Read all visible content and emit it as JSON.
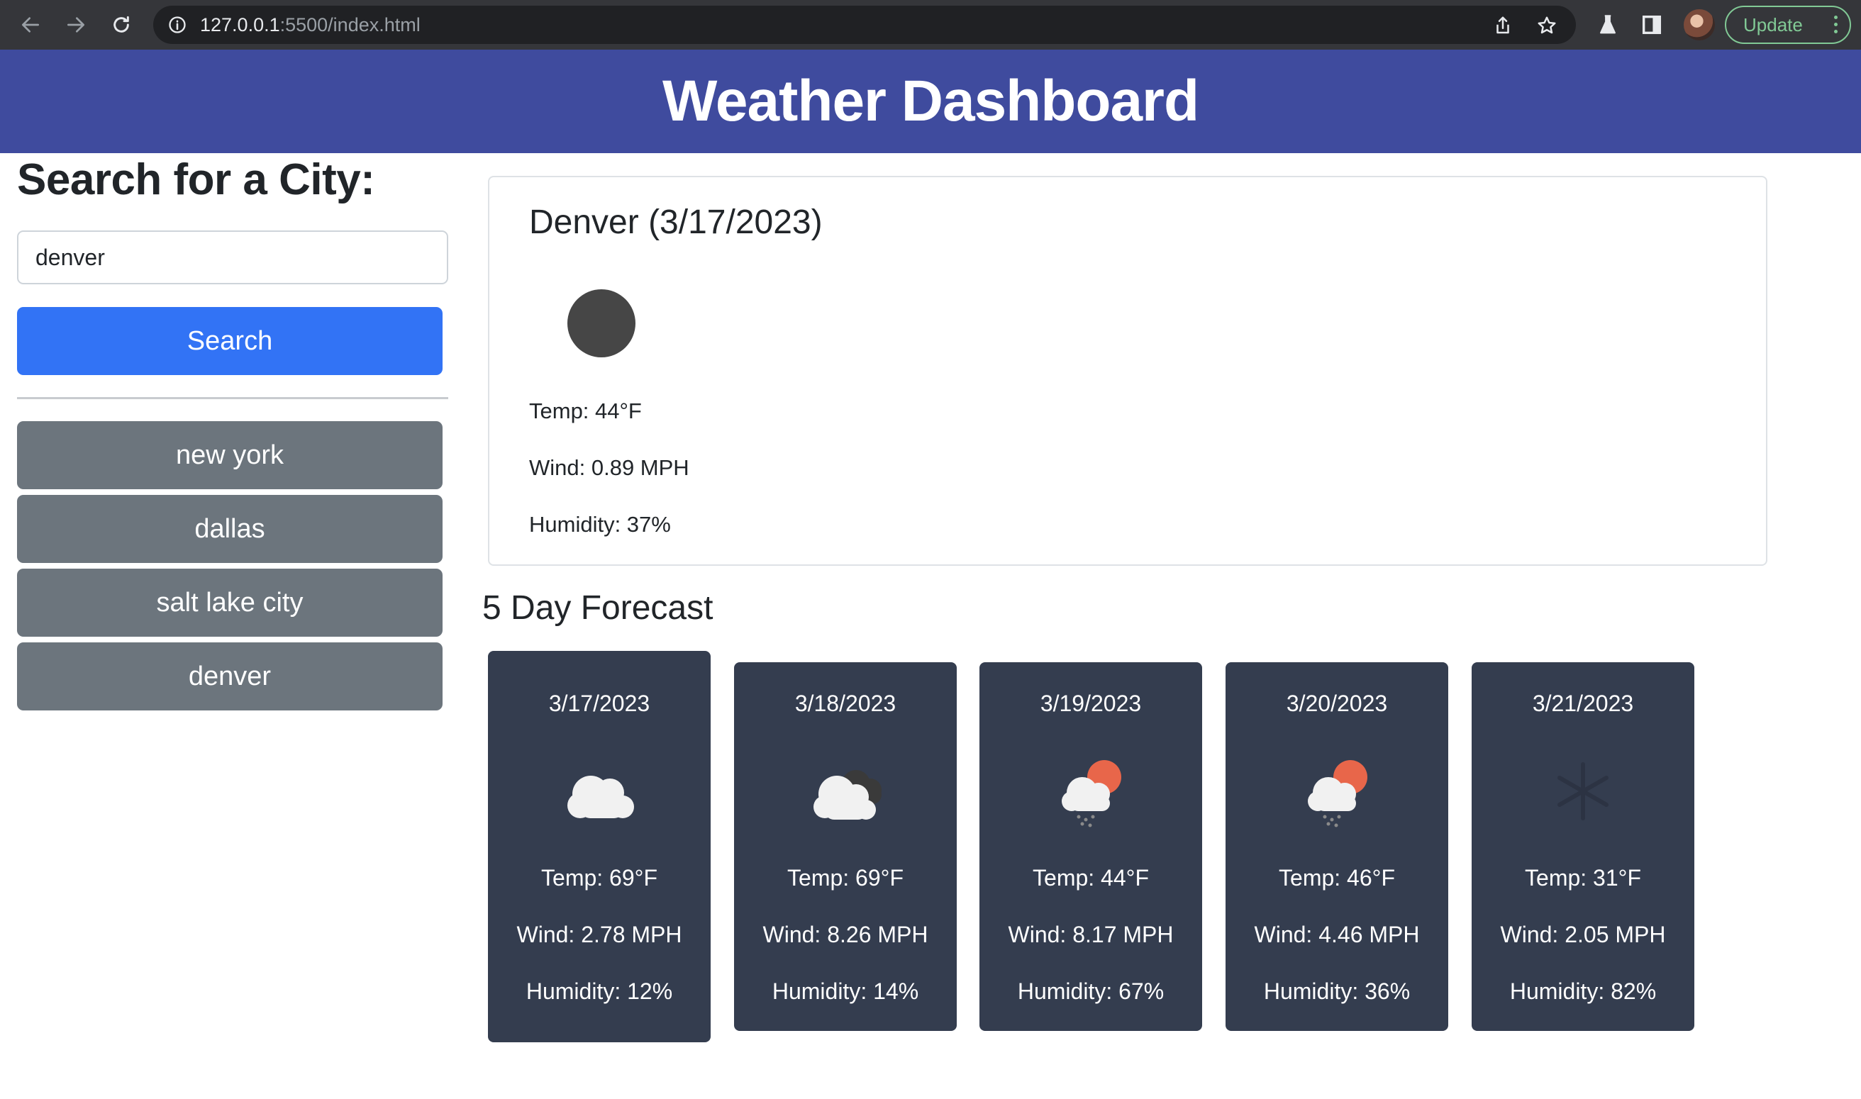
{
  "browser": {
    "url_host": "127.0.0.1",
    "url_path": ":5500/index.html",
    "update_label": "Update"
  },
  "header": {
    "title": "Weather Dashboard"
  },
  "search": {
    "heading": "Search for a City:",
    "input_value": "denver",
    "button_label": "Search"
  },
  "history": [
    "new york",
    "dallas",
    "salt lake city",
    "denver"
  ],
  "current": {
    "title": "Denver (3/17/2023)",
    "icon": "dark-circle-icon",
    "temp": "Temp: 44°F",
    "wind": "Wind: 0.89 MPH",
    "humidity": "Humidity: 37%"
  },
  "forecast": {
    "heading": "5 Day Forecast",
    "days": [
      {
        "date": "3/17/2023",
        "icon": "cloud-icon",
        "temp": "Temp: 69°F",
        "wind": "Wind: 2.78 MPH",
        "humidity": "Humidity: 12%"
      },
      {
        "date": "3/18/2023",
        "icon": "broken-clouds-icon",
        "temp": "Temp: 69°F",
        "wind": "Wind: 8.26 MPH",
        "humidity": "Humidity: 14%"
      },
      {
        "date": "3/19/2023",
        "icon": "sun-cloud-rain-icon",
        "temp": "Temp: 44°F",
        "wind": "Wind: 8.17 MPH",
        "humidity": "Humidity: 67%"
      },
      {
        "date": "3/20/2023",
        "icon": "sun-cloud-rain-icon",
        "temp": "Temp: 46°F",
        "wind": "Wind: 4.46 MPH",
        "humidity": "Humidity: 36%"
      },
      {
        "date": "3/21/2023",
        "icon": "snowflake-icon",
        "temp": "Temp: 31°F",
        "wind": "Wind: 2.05 MPH",
        "humidity": "Humidity: 82%"
      }
    ]
  },
  "colors": {
    "header_bg": "#3f4b9e",
    "search_button": "#3273f5",
    "history_button": "#6c757d",
    "forecast_card": "#343d4f"
  }
}
